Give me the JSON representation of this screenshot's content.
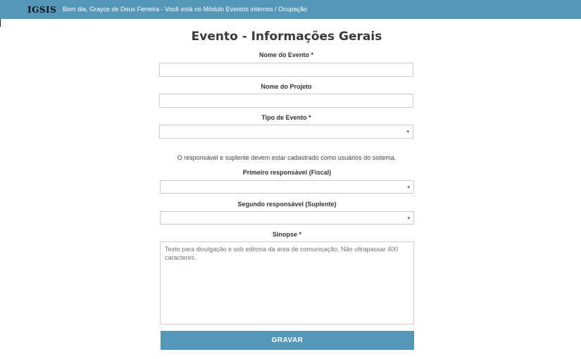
{
  "header": {
    "logo": "IGSIS",
    "greeting": "Bom dia, Grayce de Deus Ferreira - Você está no Módulo Eventos internos / Ocupação"
  },
  "form": {
    "title": "Evento - Informações Gerais",
    "nome_evento": {
      "label": "Nome do Evento *",
      "value": ""
    },
    "nome_projeto": {
      "label": "Nome do Projeto",
      "value": ""
    },
    "tipo_evento": {
      "label": "Tipo de Evento *",
      "selected": "",
      "caret": "▾"
    },
    "info_text": "O responsável e suplente devem estar cadastrado como usuários do sistema.",
    "primeiro_responsavel": {
      "label": "Primeiro responsável (Fiscal)",
      "selected": "",
      "caret": "▾"
    },
    "segundo_responsavel": {
      "label": "Segundo responsável (Suplente)",
      "selected": "",
      "caret": "▾"
    },
    "sinopse": {
      "label": "Sinopse *",
      "placeholder": "Texto para divulgação e sob editoria da area de comunicação. Não ultrapassar 400 caracteres.",
      "value": ""
    },
    "submit_label": "GRAVAR"
  },
  "colors": {
    "topbar": "#5597b9",
    "button": "#5597b9"
  }
}
